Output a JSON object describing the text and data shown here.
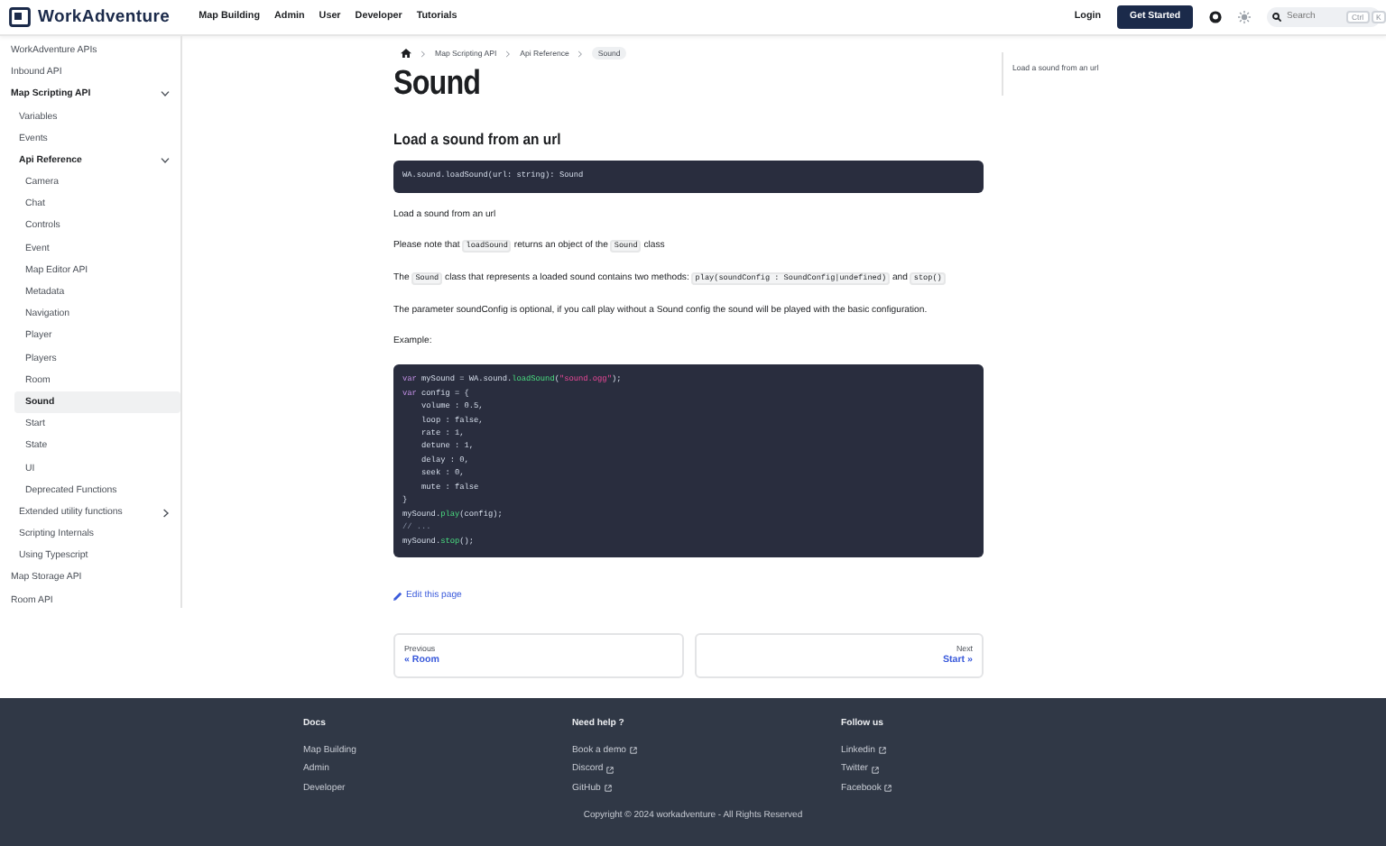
{
  "navbar": {
    "brand": "WorkAdventure",
    "links": [
      "Map Building",
      "Admin",
      "User",
      "Developer",
      "Tutorials"
    ],
    "login": "Login",
    "cta": "Get Started",
    "search": {
      "placeholder": "Search",
      "keys": [
        "Ctrl",
        "K"
      ]
    }
  },
  "sidebar": {
    "items": [
      {
        "label": "WorkAdventure APIs",
        "selected": false
      },
      {
        "label": "Inbound API",
        "selected": false
      },
      {
        "label": "Map Scripting API",
        "selected": false,
        "expanded": true,
        "children": [
          {
            "label": "Variables",
            "selected": false
          },
          {
            "label": "Events",
            "selected": false
          },
          {
            "label": "Api Reference",
            "selected": false,
            "expanded": true,
            "children": [
              {
                "label": "Camera",
                "selected": false
              },
              {
                "label": "Chat",
                "selected": false
              },
              {
                "label": "Controls",
                "selected": false
              },
              {
                "label": "Event",
                "selected": false
              },
              {
                "label": "Map Editor API",
                "selected": false
              },
              {
                "label": "Metadata",
                "selected": false
              },
              {
                "label": "Navigation",
                "selected": false
              },
              {
                "label": "Player",
                "selected": false
              },
              {
                "label": "Players",
                "selected": false
              },
              {
                "label": "Room",
                "selected": false
              },
              {
                "label": "Sound",
                "selected": true
              },
              {
                "label": "Start",
                "selected": false
              },
              {
                "label": "State",
                "selected": false
              },
              {
                "label": "UI",
                "selected": false
              },
              {
                "label": "Deprecated Functions",
                "selected": false
              }
            ]
          },
          {
            "label": "Extended utility functions",
            "selected": false,
            "expanded": false
          },
          {
            "label": "Scripting Internals",
            "selected": false
          },
          {
            "label": "Using Typescript",
            "selected": false
          }
        ]
      },
      {
        "label": "Map Storage API",
        "selected": false
      },
      {
        "label": "Room API",
        "selected": false
      }
    ]
  },
  "breadcrumbs": [
    "Map Scripting API",
    "Api Reference",
    "Sound"
  ],
  "title": "Sound",
  "blocks": [
    {
      "kind": "heading",
      "text": "Load a sound from an url"
    },
    {
      "kind": "code",
      "lines": [
        [
          {
            "text": "WA.sound.loadSound(url: string): Sound",
            "kind": "plain"
          }
        ]
      ]
    },
    {
      "kind": "paragraph",
      "parts": [
        {
          "text": "Load a sound from an url",
          "code": false
        }
      ]
    },
    {
      "kind": "paragraph",
      "parts": [
        {
          "text": "Please note that ",
          "code": false
        },
        {
          "text": "loadSound",
          "code": true
        },
        {
          "text": " returns an object of the ",
          "code": false
        },
        {
          "text": "Sound",
          "code": true
        },
        {
          "text": " class",
          "code": false
        }
      ]
    },
    {
      "kind": "paragraph",
      "parts": [
        {
          "text": "The ",
          "code": false
        },
        {
          "text": "Sound",
          "code": true
        },
        {
          "text": " class that represents a loaded sound contains two methods: ",
          "code": false
        },
        {
          "text": "play(soundConfig : SoundConfig|undefined)",
          "code": true
        },
        {
          "text": " and ",
          "code": false
        },
        {
          "text": "stop()",
          "code": true
        }
      ]
    },
    {
      "kind": "paragraph",
      "parts": [
        {
          "text": "The parameter soundConfig is optional, if you call play without a Sound config the sound will be played with the basic configuration.",
          "code": false
        }
      ]
    },
    {
      "kind": "paragraph",
      "parts": [
        {
          "text": "Example:",
          "code": false
        }
      ]
    },
    {
      "kind": "code",
      "lines": [
        [
          {
            "text": "var",
            "kind": "keyword"
          },
          {
            "text": " mySound = WA.sound.",
            "kind": "plain"
          },
          {
            "text": "loadSound",
            "kind": "function"
          },
          {
            "text": "(",
            "kind": "plain"
          },
          {
            "text": "\"sound.ogg\"",
            "kind": "string"
          },
          {
            "text": ");",
            "kind": "plain"
          }
        ],
        [
          {
            "text": "var",
            "kind": "keyword"
          },
          {
            "text": " config = {",
            "kind": "plain"
          }
        ],
        [
          {
            "text": "    volume : 0.5,",
            "kind": "plain"
          }
        ],
        [
          {
            "text": "    loop : false,",
            "kind": "plain"
          }
        ],
        [
          {
            "text": "    rate : 1,",
            "kind": "plain"
          }
        ],
        [
          {
            "text": "    detune : 1,",
            "kind": "plain"
          }
        ],
        [
          {
            "text": "    delay : 0,",
            "kind": "plain"
          }
        ],
        [
          {
            "text": "    seek : 0,",
            "kind": "plain"
          }
        ],
        [
          {
            "text": "    mute : false",
            "kind": "plain"
          }
        ],
        [
          {
            "text": "}",
            "kind": "plain"
          }
        ],
        [
          {
            "text": "mySound.",
            "kind": "plain"
          },
          {
            "text": "play",
            "kind": "function"
          },
          {
            "text": "(config);",
            "kind": "plain"
          }
        ],
        [
          {
            "text": "// ...",
            "kind": "comment"
          }
        ],
        [
          {
            "text": "mySound.",
            "kind": "plain"
          },
          {
            "text": "stop",
            "kind": "function"
          },
          {
            "text": "();",
            "kind": "plain"
          }
        ]
      ]
    }
  ],
  "edit_link": "Edit this page",
  "pager": {
    "previous": {
      "label": "Previous",
      "title": "« Room"
    },
    "next": {
      "label": "Next",
      "title": "Start »"
    }
  },
  "toc": [
    "Load a sound from an url"
  ],
  "footer": {
    "columns": [
      {
        "title": "Docs",
        "links": [
          {
            "text": "Map Building",
            "external": false
          },
          {
            "text": "Admin",
            "external": false
          },
          {
            "text": "Developer",
            "external": false
          }
        ]
      },
      {
        "title": "Need help ?",
        "links": [
          {
            "text": "Book a demo",
            "external": true
          },
          {
            "text": "Discord",
            "external": true
          },
          {
            "text": "GitHub",
            "external": true
          }
        ]
      },
      {
        "title": "Follow us",
        "links": [
          {
            "text": "Linkedin",
            "external": true
          },
          {
            "text": "Twitter",
            "external": true
          },
          {
            "text": "Facebook",
            "external": true
          }
        ]
      }
    ],
    "copyright": "Copyright © 2024 workadventure - All Rights Reserved"
  }
}
